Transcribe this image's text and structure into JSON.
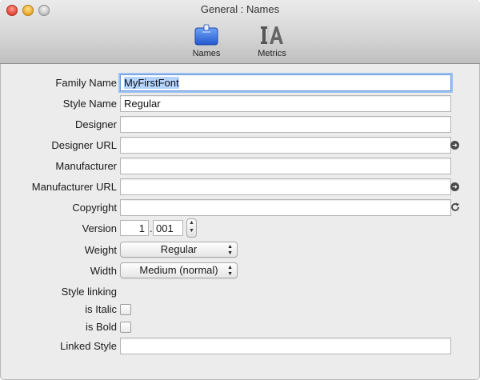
{
  "window": {
    "title": "General : Names"
  },
  "toolbar": {
    "items": [
      {
        "label": "Names",
        "icon": "folder-icon",
        "selected": true
      },
      {
        "label": "Metrics",
        "icon": "metrics-icon",
        "selected": false
      }
    ]
  },
  "form": {
    "family_name": {
      "label": "Family Name",
      "value": "MyFirstFont"
    },
    "style_name": {
      "label": "Style Name",
      "value": "Regular"
    },
    "designer": {
      "label": "Designer",
      "value": ""
    },
    "designer_url": {
      "label": "Designer URL",
      "value": ""
    },
    "manufacturer": {
      "label": "Manufacturer",
      "value": ""
    },
    "manufacturer_url": {
      "label": "Manufacturer URL",
      "value": ""
    },
    "copyright": {
      "label": "Copyright",
      "value": ""
    },
    "version": {
      "label": "Version",
      "major": "1",
      "separator": ".",
      "minor": "001"
    },
    "weight": {
      "label": "Weight",
      "selected": "Regular"
    },
    "width": {
      "label": "Width",
      "selected": "Medium (normal)"
    },
    "style_linking": {
      "label": "Style linking"
    },
    "is_italic": {
      "label": "is Italic",
      "checked": false
    },
    "is_bold": {
      "label": "is Bold",
      "checked": false
    },
    "linked_style": {
      "label": "Linked Style",
      "value": ""
    }
  },
  "colors": {
    "accent": "#3b6fd8",
    "focus_ring": "#9cc0f0",
    "selection": "#b4d4fe"
  }
}
